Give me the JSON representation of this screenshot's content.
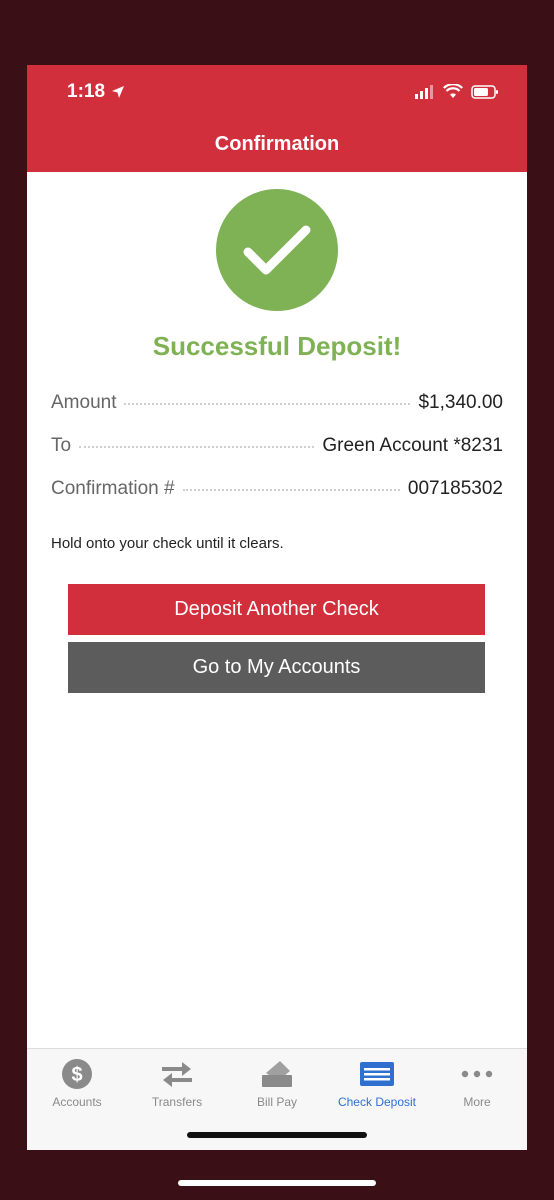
{
  "status_bar": {
    "time": "1:18"
  },
  "header": {
    "title": "Confirmation"
  },
  "result": {
    "title": "Successful Deposit!"
  },
  "details": [
    {
      "label": "Amount",
      "value": "$1,340.00"
    },
    {
      "label": "To",
      "value": "Green Account *8231"
    },
    {
      "label": "Confirmation #",
      "value": "007185302"
    }
  ],
  "note": "Hold onto your check until it clears.",
  "actions": {
    "primary_label": "Deposit Another Check",
    "secondary_label": "Go to My Accounts"
  },
  "tabs": [
    {
      "label": "Accounts",
      "icon": "dollar-icon"
    },
    {
      "label": "Transfers",
      "icon": "transfer-arrows-icon"
    },
    {
      "label": "Bill Pay",
      "icon": "bill-pay-icon"
    },
    {
      "label": "Check Deposit",
      "icon": "check-deposit-icon",
      "active": true
    },
    {
      "label": "More",
      "icon": "more-dots-icon"
    }
  ],
  "colors": {
    "brand_red": "#d12f3c",
    "success_green": "#7fb155",
    "secondary_gray": "#5c5c5c",
    "active_tab_blue": "#2f6fd0"
  }
}
